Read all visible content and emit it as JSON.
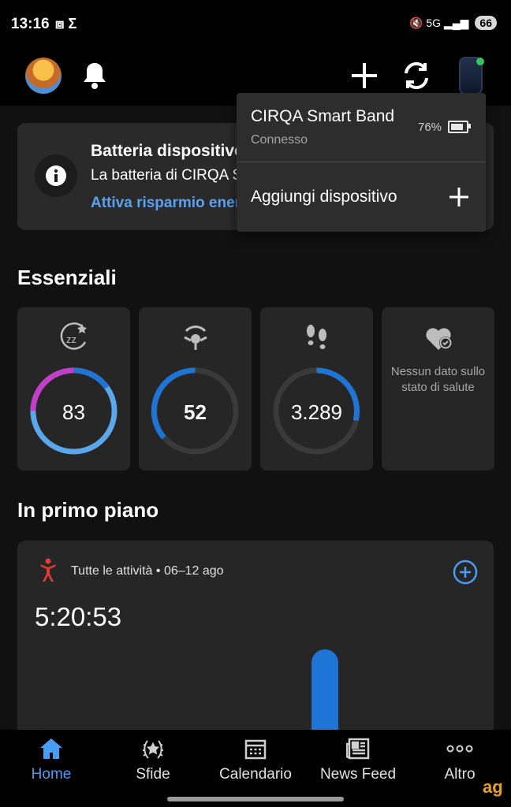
{
  "status_bar": {
    "time": "13:16",
    "left_icons": "⧈ Σ",
    "right_icons": "🔇 5G ▂▄▆",
    "battery": "66"
  },
  "top_bar": {
    "avatar": "avatar",
    "icons": [
      "bell-icon",
      "plus-icon",
      "sync-icon",
      "band-icon"
    ]
  },
  "notice": {
    "title": "Batteria dispositivo",
    "text": "La batteria di CIRQA Smart Band",
    "link": "Attiva risparmio energetico"
  },
  "dropdown": {
    "device_name": "CIRQA Smart Band",
    "device_status": "Connesso",
    "battery_percent": "76%",
    "battery_level": 0.76,
    "add_label": "Aggiungi dispositivo"
  },
  "essentials": {
    "title": "Essenziali",
    "tiles": [
      {
        "name": "sleep",
        "value": "83",
        "icon": "sleep-icon"
      },
      {
        "name": "stress",
        "value": "52",
        "icon": "body-battery-icon"
      },
      {
        "name": "steps",
        "value": "3.289",
        "icon": "footsteps-icon"
      },
      {
        "name": "health",
        "message": "Nessun dato sullo stato di salute",
        "icon": "heart-check-icon"
      }
    ]
  },
  "featured": {
    "title": "In primo piano",
    "activity_label": "Tutte le attività • 06–12 ago",
    "total_time": "5:20:53"
  },
  "bottom_nav": {
    "items": [
      {
        "label": "Home",
        "icon": "home-icon",
        "active": true
      },
      {
        "label": "Sfide",
        "icon": "laurel-icon"
      },
      {
        "label": "Calendario",
        "icon": "calendar-icon"
      },
      {
        "label": "News Feed",
        "icon": "news-icon"
      },
      {
        "label": "Altro",
        "icon": "more-icon"
      }
    ]
  },
  "watermark": "ag"
}
